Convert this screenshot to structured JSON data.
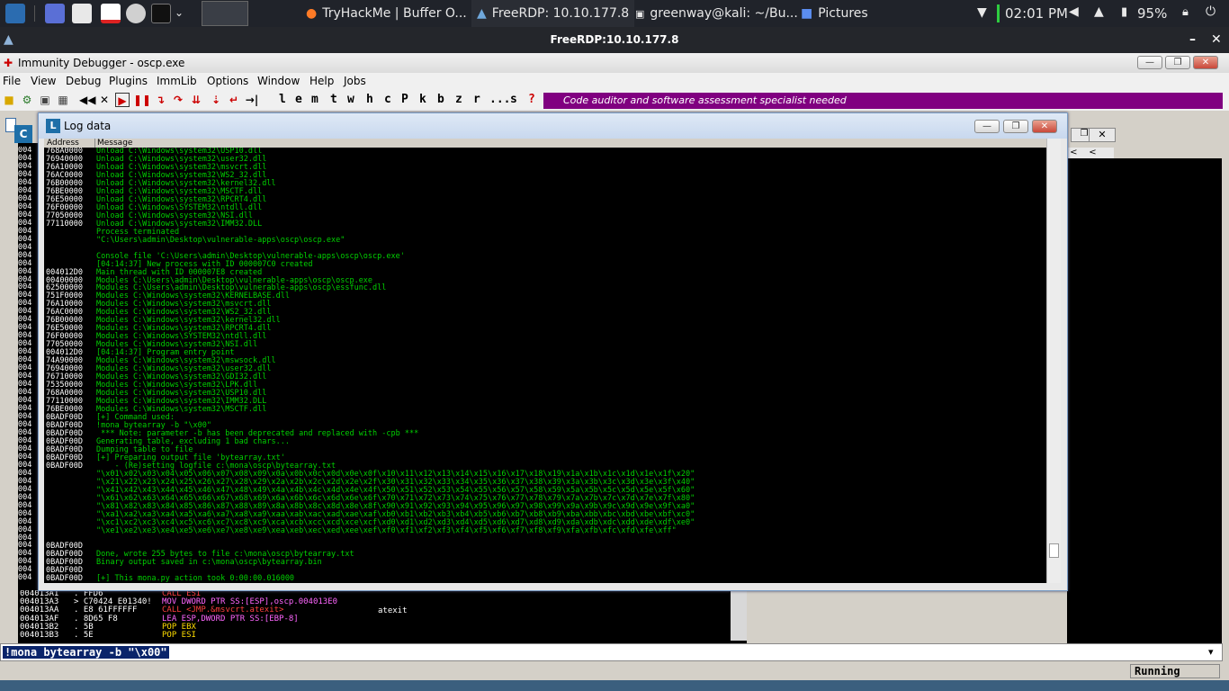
{
  "taskbar": {
    "tasks": [
      {
        "label": "TryHackMe | Buffer O..."
      },
      {
        "label": "FreeRDP: 10.10.177.8"
      },
      {
        "label": "greenway@kali: ~/Bu..."
      },
      {
        "label": "Pictures"
      }
    ],
    "time": "02:01 PM",
    "battery": "95%"
  },
  "rdp_window": {
    "title": "FreeRDP:10.10.177.8"
  },
  "immunity": {
    "title": "Immunity Debugger - oscp.exe",
    "menu": [
      "File",
      "View",
      "Debug",
      "Plugins",
      "ImmLib",
      "Options",
      "Window",
      "Help",
      "Jobs"
    ],
    "toolbar_letters": [
      "l",
      "e",
      "m",
      "t",
      "w",
      "h",
      "c",
      "P",
      "k",
      "b",
      "z",
      "r",
      "...",
      "s",
      "?"
    ],
    "banner": "Code auditor and software assessment specialist needed"
  },
  "log_window": {
    "title": "Log data",
    "col_address": "Address",
    "col_message": "Message",
    "rows": [
      {
        "a": "768A0000",
        "m": "Unload C:\\Windows\\system32\\USP10.dll"
      },
      {
        "a": "76940000",
        "m": "Unload C:\\Windows\\system32\\user32.dll"
      },
      {
        "a": "76A10000",
        "m": "Unload C:\\Windows\\system32\\msvcrt.dll"
      },
      {
        "a": "76AC0000",
        "m": "Unload C:\\Windows\\system32\\WS2_32.dll"
      },
      {
        "a": "76B00000",
        "m": "Unload C:\\Windows\\system32\\kernel32.dll"
      },
      {
        "a": "76BE0000",
        "m": "Unload C:\\Windows\\system32\\MSCTF.dll"
      },
      {
        "a": "76E50000",
        "m": "Unload C:\\Windows\\system32\\RPCRT4.dll"
      },
      {
        "a": "76F00000",
        "m": "Unload C:\\Windows\\SYSTEM32\\ntdll.dll"
      },
      {
        "a": "77050000",
        "m": "Unload C:\\Windows\\system32\\NSI.dll"
      },
      {
        "a": "77110000",
        "m": "Unload C:\\Windows\\system32\\IMM32.DLL"
      },
      {
        "a": "",
        "m": "Process terminated"
      },
      {
        "a": "",
        "m": "\"C:\\Users\\admin\\Desktop\\vulnerable-apps\\oscp\\oscp.exe\""
      },
      {
        "a": "",
        "m": ""
      },
      {
        "a": "",
        "m": "Console file 'C:\\Users\\admin\\Desktop\\vulnerable-apps\\oscp\\oscp.exe'"
      },
      {
        "a": "",
        "m": "[04:14:37] New process with ID 000007C0 created"
      },
      {
        "a": "004012D0",
        "m": "Main thread with ID 000007E8 created"
      },
      {
        "a": "00400000",
        "m": "Modules C:\\Users\\admin\\Desktop\\vulnerable-apps\\oscp\\oscp.exe"
      },
      {
        "a": "62500000",
        "m": "Modules C:\\Users\\admin\\Desktop\\vulnerable-apps\\oscp\\essfunc.dll"
      },
      {
        "a": "751F0000",
        "m": "Modules C:\\Windows\\system32\\KERNELBASE.dll"
      },
      {
        "a": "76A10000",
        "m": "Modules C:\\Windows\\system32\\msvcrt.dll"
      },
      {
        "a": "76AC0000",
        "m": "Modules C:\\Windows\\system32\\WS2_32.dll"
      },
      {
        "a": "76B00000",
        "m": "Modules C:\\Windows\\system32\\kernel32.dll"
      },
      {
        "a": "76E50000",
        "m": "Modules C:\\Windows\\system32\\RPCRT4.dll"
      },
      {
        "a": "76F00000",
        "m": "Modules C:\\Windows\\SYSTEM32\\ntdll.dll"
      },
      {
        "a": "77050000",
        "m": "Modules C:\\Windows\\system32\\NSI.dll"
      },
      {
        "a": "004012D0",
        "m": "[04:14:37] Program entry point"
      },
      {
        "a": "74A90000",
        "m": "Modules C:\\Windows\\system32\\mswsock.dll"
      },
      {
        "a": "76940000",
        "m": "Modules C:\\Windows\\system32\\user32.dll"
      },
      {
        "a": "76710000",
        "m": "Modules C:\\Windows\\system32\\GDI32.dll"
      },
      {
        "a": "75350000",
        "m": "Modules C:\\Windows\\system32\\LPK.dll"
      },
      {
        "a": "768A0000",
        "m": "Modules C:\\Windows\\system32\\USP10.dll"
      },
      {
        "a": "77110000",
        "m": "Modules C:\\Windows\\system32\\IMM32.DLL"
      },
      {
        "a": "76BE0000",
        "m": "Modules C:\\Windows\\system32\\MSCTF.dll"
      },
      {
        "a": "0BADF00D",
        "m": "[+] Command used:"
      },
      {
        "a": "0BADF00D",
        "m": "!mona bytearray -b \"\\x00\""
      },
      {
        "a": "0BADF00D",
        "m": " *** Note: parameter -b has been deprecated and replaced with -cpb ***"
      },
      {
        "a": "0BADF00D",
        "m": "Generating table, excluding 1 bad chars..."
      },
      {
        "a": "0BADF00D",
        "m": "Dumping table to file"
      },
      {
        "a": "0BADF00D",
        "m": "[+] Preparing output file 'bytearray.txt'"
      },
      {
        "a": "0BADF00D",
        "m": "    - (Re)setting logfile c:\\mona\\oscp\\bytearray.txt"
      },
      {
        "a": "",
        "m": "\"\\x01\\x02\\x03\\x04\\x05\\x06\\x07\\x08\\x09\\x0a\\x0b\\x0c\\x0d\\x0e\\x0f\\x10\\x11\\x12\\x13\\x14\\x15\\x16\\x17\\x18\\x19\\x1a\\x1b\\x1c\\x1d\\x1e\\x1f\\x20\""
      },
      {
        "a": "",
        "m": "\"\\x21\\x22\\x23\\x24\\x25\\x26\\x27\\x28\\x29\\x2a\\x2b\\x2c\\x2d\\x2e\\x2f\\x30\\x31\\x32\\x33\\x34\\x35\\x36\\x37\\x38\\x39\\x3a\\x3b\\x3c\\x3d\\x3e\\x3f\\x40\""
      },
      {
        "a": "",
        "m": "\"\\x41\\x42\\x43\\x44\\x45\\x46\\x47\\x48\\x49\\x4a\\x4b\\x4c\\x4d\\x4e\\x4f\\x50\\x51\\x52\\x53\\x54\\x55\\x56\\x57\\x58\\x59\\x5a\\x5b\\x5c\\x5d\\x5e\\x5f\\x60\""
      },
      {
        "a": "",
        "m": "\"\\x61\\x62\\x63\\x64\\x65\\x66\\x67\\x68\\x69\\x6a\\x6b\\x6c\\x6d\\x6e\\x6f\\x70\\x71\\x72\\x73\\x74\\x75\\x76\\x77\\x78\\x79\\x7a\\x7b\\x7c\\x7d\\x7e\\x7f\\x80\""
      },
      {
        "a": "",
        "m": "\"\\x81\\x82\\x83\\x84\\x85\\x86\\x87\\x88\\x89\\x8a\\x8b\\x8c\\x8d\\x8e\\x8f\\x90\\x91\\x92\\x93\\x94\\x95\\x96\\x97\\x98\\x99\\x9a\\x9b\\x9c\\x9d\\x9e\\x9f\\xa0\""
      },
      {
        "a": "",
        "m": "\"\\xa1\\xa2\\xa3\\xa4\\xa5\\xa6\\xa7\\xa8\\xa9\\xaa\\xab\\xac\\xad\\xae\\xaf\\xb0\\xb1\\xb2\\xb3\\xb4\\xb5\\xb6\\xb7\\xb8\\xb9\\xba\\xbb\\xbc\\xbd\\xbe\\xbf\\xc0\""
      },
      {
        "a": "",
        "m": "\"\\xc1\\xc2\\xc3\\xc4\\xc5\\xc6\\xc7\\xc8\\xc9\\xca\\xcb\\xcc\\xcd\\xce\\xcf\\xd0\\xd1\\xd2\\xd3\\xd4\\xd5\\xd6\\xd7\\xd8\\xd9\\xda\\xdb\\xdc\\xdd\\xde\\xdf\\xe0\""
      },
      {
        "a": "",
        "m": "\"\\xe1\\xe2\\xe3\\xe4\\xe5\\xe6\\xe7\\xe8\\xe9\\xea\\xeb\\xec\\xed\\xee\\xef\\xf0\\xf1\\xf2\\xf3\\xf4\\xf5\\xf6\\xf7\\xf8\\xf9\\xfa\\xfb\\xfc\\xfd\\xfe\\xff\""
      },
      {
        "a": "",
        "m": ""
      },
      {
        "a": "0BADF00D",
        "m": ""
      },
      {
        "a": "0BADF00D",
        "m": "Done, wrote 255 bytes to file c:\\mona\\oscp\\bytearray.txt"
      },
      {
        "a": "0BADF00D",
        "m": "Binary output saved in c:\\mona\\oscp\\bytearray.bin"
      },
      {
        "a": "0BADF00D",
        "m": ""
      },
      {
        "a": "0BADF00D",
        "m": "[+] This mona.py action took 0:00:00.016000"
      }
    ]
  },
  "disasm_rows": [
    {
      "addr": "004013A1",
      "hex": ". FFD6",
      "instr": "CALL ESI"
    },
    {
      "addr": "004013A3",
      "hex": "> C70424 E01340!",
      "instr": "MOV DWORD PTR SS:[ESP],oscp.004013E0"
    },
    {
      "addr": "004013AA",
      "hex": ". E8 61FFFFFF",
      "instr": "CALL <JMP.&msvcrt.atexit>"
    },
    {
      "addr": "004013AF",
      "hex": ". 8D65 F8",
      "instr": "LEA ESP,DWORD PTR SS:[EBP-8]"
    },
    {
      "addr": "004013B2",
      "hex": ". 5B",
      "instr": "POP EBX"
    },
    {
      "addr": "004013B3",
      "hex": ". 5E",
      "instr": "POP ESI"
    }
  ],
  "disasm_comment": "atexit",
  "command_bar": {
    "value": "!mona bytearray -b \"\\x00\""
  },
  "status": {
    "state": "Running"
  },
  "left_gutter": "004",
  "colors": {
    "log_text": "#00d000",
    "banner": "#800080",
    "selection": "#0a246a"
  }
}
